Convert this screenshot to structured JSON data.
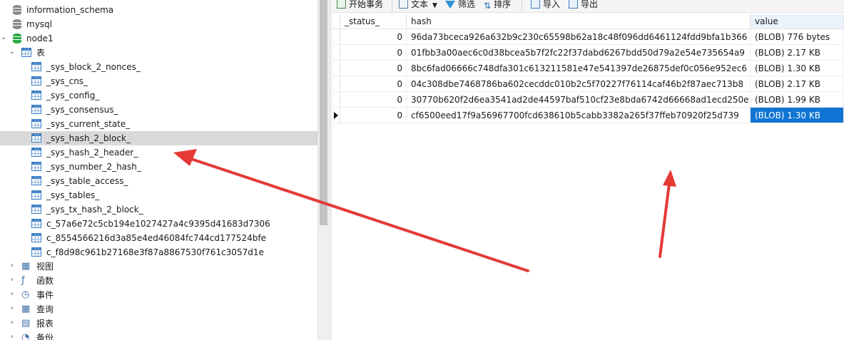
{
  "tree": {
    "databases": [
      {
        "label": "information_schema"
      },
      {
        "label": "mysql"
      },
      {
        "label": "node1"
      }
    ],
    "tables_group_label": "表",
    "tables": [
      "_sys_block_2_nonces_",
      "_sys_cns_",
      "_sys_config_",
      "_sys_consensus_",
      "_sys_current_state_",
      "_sys_hash_2_block_",
      "_sys_hash_2_header_",
      "_sys_number_2_hash_",
      "_sys_table_access_",
      "_sys_tables_",
      "_sys_tx_hash_2_block_",
      "c_57a6e72c5cb194e1027427a4c9395d41683d7306",
      "c_8554566216d3a85e4ed46084fc744cd177524bfe",
      "c_f8d98c961b27168e3f87a8867530f761c3057d1e"
    ],
    "selected_table": "_sys_hash_2_block_",
    "groups": [
      "视图",
      "函数",
      "事件",
      "查询",
      "报表",
      "备份"
    ]
  },
  "toolbar": {
    "begin_transaction": "开始事务",
    "text": "文本",
    "filter": "筛选",
    "sort": "排序",
    "import": "导入",
    "export": "导出"
  },
  "grid": {
    "columns": [
      "_status_",
      "hash",
      "value"
    ],
    "rows": [
      {
        "status": "0",
        "hash": "96da73bceca926a632b9c230c65598b62a18c48f096dd6461124fdd9bfa1b366",
        "value": "(BLOB) 776 bytes"
      },
      {
        "status": "0",
        "hash": "01fbb3a00aec6c0d38bcea5b7f2fc22f37dabd6267bdd50d79a2e54e735654a9",
        "value": "(BLOB) 2.17 KB"
      },
      {
        "status": "0",
        "hash": "8bc6fad06666c748dfa301c613211581e47e541397de26875def0c056e952ec6",
        "value": "(BLOB) 1.30 KB"
      },
      {
        "status": "0",
        "hash": "04c308dbe7468786ba602cecddc010b2c5f70227f76114caf46b2f87aec713b8",
        "value": "(BLOB) 2.17 KB"
      },
      {
        "status": "0",
        "hash": "30770b620f2d6ea3541ad2de44597baf510cf23e8bda6742d66668ad1ecd250e",
        "value": "(BLOB) 1.99 KB"
      },
      {
        "status": "0",
        "hash": "cf6500eed17f9a56967700fcd638610b5cabb3382a265f37ffeb70920f25d739",
        "value": "(BLOB) 1.30 KB"
      }
    ],
    "selected_row": 6
  },
  "colors": {
    "accent": "#0f75d4",
    "annotation_arrow": "#e53935",
    "db_connected": "#27a844"
  }
}
